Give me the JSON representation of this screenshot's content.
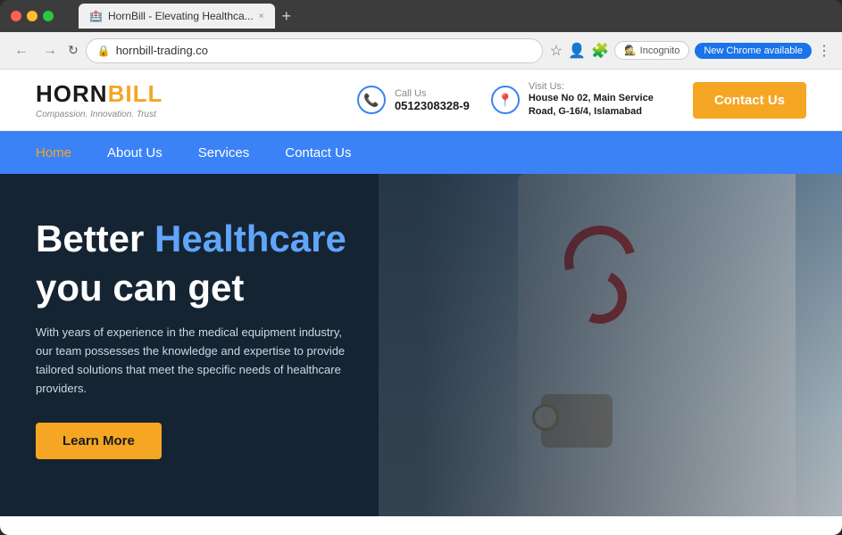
{
  "browser": {
    "tab_title": "HornBill - Elevating Healthca...",
    "tab_close": "×",
    "tab_new": "+",
    "back_btn": "←",
    "forward_btn": "→",
    "refresh_btn": "↻",
    "address": "hornbill-trading.co",
    "incognito_label": "Incognito",
    "chrome_available": "New Chrome available",
    "lock_icon": "🔒"
  },
  "header": {
    "logo_part1": "HORN",
    "logo_part2": "BILL",
    "tagline": "Compassion. Innovation. Trust",
    "call_label": "Call Us",
    "call_number": "0512308328-9",
    "visit_label": "Visit Us:",
    "visit_address": "House No 02, Main Service Road, G-16/4, Islamabad",
    "contact_btn": "Contact Us"
  },
  "nav": {
    "items": [
      {
        "label": "Home",
        "active": true
      },
      {
        "label": "About Us",
        "active": false
      },
      {
        "label": "Services",
        "active": false
      },
      {
        "label": "Contact Us",
        "active": false
      }
    ]
  },
  "hero": {
    "title_prefix": "Better ",
    "title_colored": "Healthcare",
    "title_line2": "you can get",
    "description": "With years of experience in the medical equipment industry, our team possesses the knowledge and expertise to provide tailored solutions that meet the specific needs of healthcare providers.",
    "cta_label": "Learn More"
  },
  "colors": {
    "accent_orange": "#f5a623",
    "accent_blue": "#3b82f6",
    "hero_blue": "#60a5fa"
  }
}
